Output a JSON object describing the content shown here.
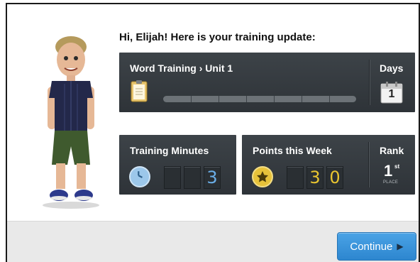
{
  "greeting": "Hi, Elijah! Here is your training update:",
  "word_panel": {
    "title": "Word Training › Unit 1",
    "progress_fraction": 0.0,
    "segments": 7
  },
  "days": {
    "label": "Days",
    "value": "1"
  },
  "minutes": {
    "label": "Training Minutes",
    "digits": [
      "",
      "",
      "3"
    ]
  },
  "points": {
    "label": "Points this Week",
    "digits": [
      "",
      "3",
      "0"
    ]
  },
  "rank": {
    "label": "Rank",
    "value": "1",
    "suffix": "st",
    "place_label": "PLACE"
  },
  "footer": {
    "continue_label": "Continue"
  },
  "colors": {
    "panel": "#3d4348",
    "button": "#2d86cf",
    "minutes_digit": "#6aaee8",
    "points_digit": "#e8c430"
  }
}
